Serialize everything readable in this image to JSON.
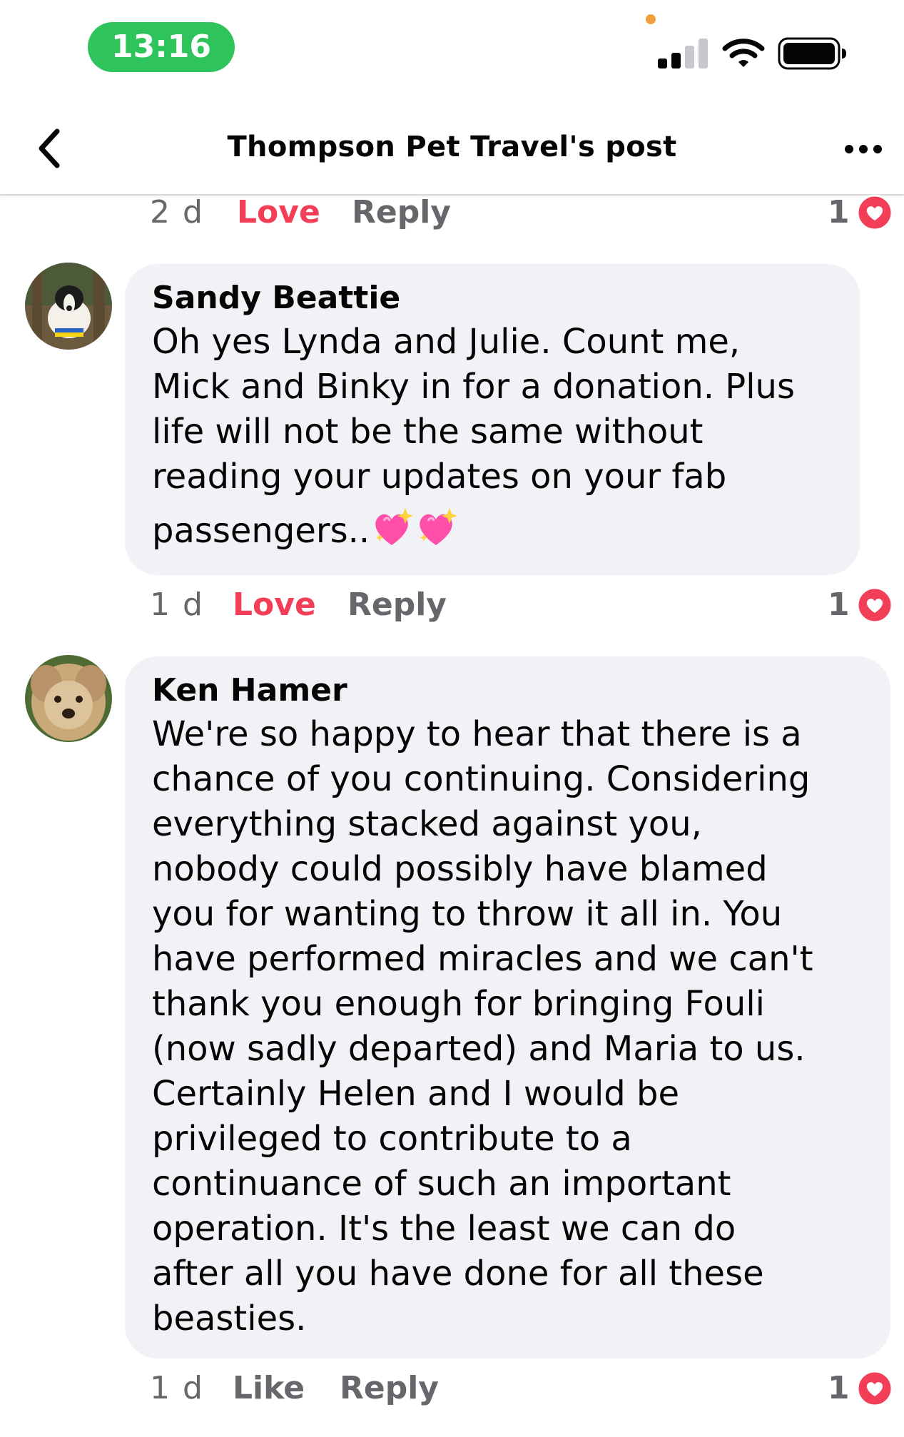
{
  "status_bar": {
    "time": "13:16",
    "accent_color": "#2fc35b",
    "icons": [
      "signal-icon",
      "wifi-icon",
      "battery-icon"
    ]
  },
  "header": {
    "title": "Thompson Pet Travel's post",
    "back_icon": "chevron-left-icon",
    "more_icon": "more-dots-icon"
  },
  "colors": {
    "love": "#f33e58",
    "muted": "#65676b",
    "bubble": "#f0f2f5"
  },
  "comments": [
    {
      "partial": true,
      "time": "2 d",
      "reaction_label": "Love",
      "reply_label": "Reply",
      "reaction_count": "1"
    },
    {
      "author": "Sandy Beattie",
      "text_lines": "Oh yes Lynda and Julie. Count me,\nMick and Binky in for a donation. Plus\nlife will not be the same without\nreading your updates on your fab",
      "text_last": "passengers..",
      "emoji": "💖💖",
      "time": "1 d",
      "reaction_label": "Love",
      "reply_label": "Reply",
      "reaction_count": "1"
    },
    {
      "author": "Ken Hamer",
      "text_lines": "We're so happy to hear that there is a\nchance of you continuing.  Considering\neverything stacked against you,\nnobody could possibly have blamed\nyou for wanting to throw it all in.  You\nhave performed miracles and we can't\nthank you enough for bringing Fouli\n(now sadly departed) and Maria to us.\nCertainly Helen and I would be\nprivileged to contribute to a\ncontinuance of such an important\noperation.  It's the least we can do\nafter all you have done for all these\nbeasties.",
      "time": "1 d",
      "reaction_label": "Like",
      "reply_label": "Reply",
      "reaction_count": "1"
    }
  ]
}
